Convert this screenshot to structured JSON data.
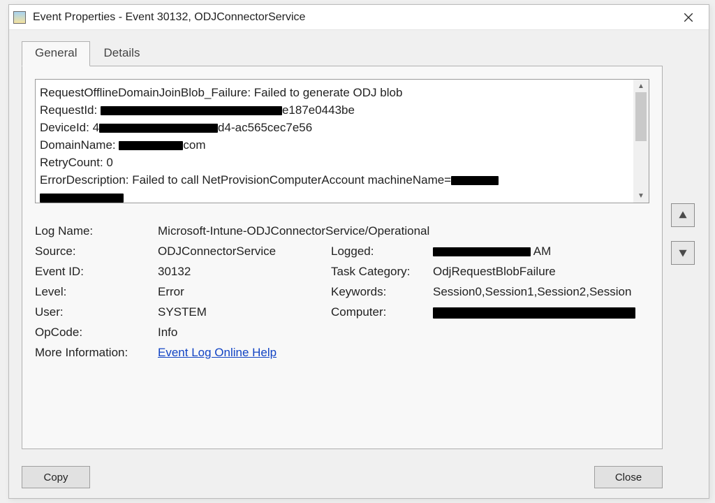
{
  "window": {
    "title": "Event Properties - Event 30132, ODJConnectorService"
  },
  "tabs": {
    "general": "General",
    "details": "Details"
  },
  "message": {
    "line1_pre": "RequestOfflineDomainJoinBlob_Failure: Failed to generate ODJ blob",
    "line2_pre": "RequestId: ",
    "line2_post": "e187e0443be",
    "line3_pre": "DeviceId: 4",
    "line3_post": "d4-ac565cec7e56",
    "line4_pre": "DomainName: ",
    "line4_post": "com",
    "line5": "RetryCount: 0",
    "line6_pre": "ErrorDescription: Failed to call NetProvisionComputerAccount machineName="
  },
  "labels": {
    "logname": "Log Name:",
    "source": "Source:",
    "eventid": "Event ID:",
    "level": "Level:",
    "user": "User:",
    "opcode": "OpCode:",
    "moreinfo": "More Information:",
    "logged": "Logged:",
    "taskcat": "Task Category:",
    "keywords": "Keywords:",
    "computer": "Computer:"
  },
  "values": {
    "logname": "Microsoft-Intune-ODJConnectorService/Operational",
    "source": "ODJConnectorService",
    "eventid": "30132",
    "level": "Error",
    "user": "SYSTEM",
    "opcode": "Info",
    "moreinfo_link": "Event Log Online Help",
    "logged_suffix": " AM",
    "taskcat": "OdjRequestBlobFailure",
    "keywords": "Session0,Session1,Session2,Session"
  },
  "buttons": {
    "copy": "Copy",
    "close": "Close"
  }
}
